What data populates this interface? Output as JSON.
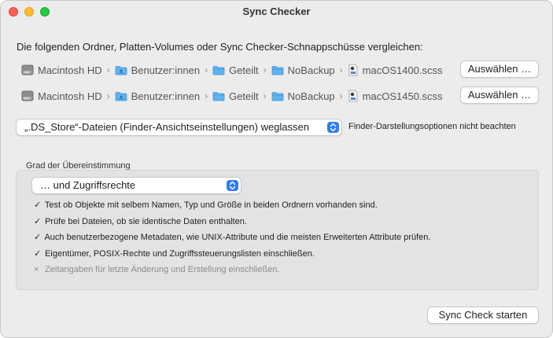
{
  "window": {
    "title": "Sync Checker"
  },
  "intro_text": "Die folgenden Ordner, Platten-Volumes oder Sync Checker-Schnappschüsse vergleichen:",
  "paths": [
    {
      "crumbs": [
        {
          "label": "Macintosh HD",
          "icon": "hard-disk-icon"
        },
        {
          "label": "Benutzer:innen",
          "icon": "users-folder-icon"
        },
        {
          "label": "Geteilt",
          "icon": "folder-icon"
        },
        {
          "label": "NoBackup",
          "icon": "folder-icon"
        },
        {
          "label": "macOS1400.scss",
          "icon": "snapshot-file-icon"
        }
      ],
      "choose_label": "Auswählen …"
    },
    {
      "crumbs": [
        {
          "label": "Macintosh HD",
          "icon": "hard-disk-icon"
        },
        {
          "label": "Benutzer:innen",
          "icon": "users-folder-icon"
        },
        {
          "label": "Geteilt",
          "icon": "folder-icon"
        },
        {
          "label": "NoBackup",
          "icon": "folder-icon"
        },
        {
          "label": "macOS1450.scss",
          "icon": "snapshot-file-icon"
        }
      ],
      "choose_label": "Auswählen …"
    }
  ],
  "ds_store_popup": {
    "selected": "„.DS_Store“-Dateien (Finder-Ansichtseinstellungen) weglassen"
  },
  "finder_option_label": "Finder-Darstellungsoptionen nicht beachten",
  "match_level": {
    "title": "Grad der Übereinstimmung",
    "selected": "… und Zugriffsrechte",
    "items": [
      {
        "mark": "✓",
        "text": "Test ob Objekte mit selbem Namen, Typ und Größe in beiden Ordnern vorhanden sind.",
        "enabled": true
      },
      {
        "mark": "✓",
        "text": "Prüfe bei Dateien, ob sie identische Daten enthalten.",
        "enabled": true
      },
      {
        "mark": "✓",
        "text": "Auch benutzerbezogene Metadaten, wie UNIX-Attribute und die meisten Erweiterten Attribute prüfen.",
        "enabled": true
      },
      {
        "mark": "✓",
        "text": "Eigentümer, POSIX-Rechte und Zugriffssteuerungslisten einschließen.",
        "enabled": true
      },
      {
        "mark": "×",
        "text": "Zeitangaben für letzte Änderung und Erstellung einschließen.",
        "enabled": false
      }
    ]
  },
  "start_button_label": "Sync Check starten",
  "colors": {
    "accent": "#2f7cf6",
    "folder": "#5fb4f0",
    "window_bg": "#ececec"
  }
}
